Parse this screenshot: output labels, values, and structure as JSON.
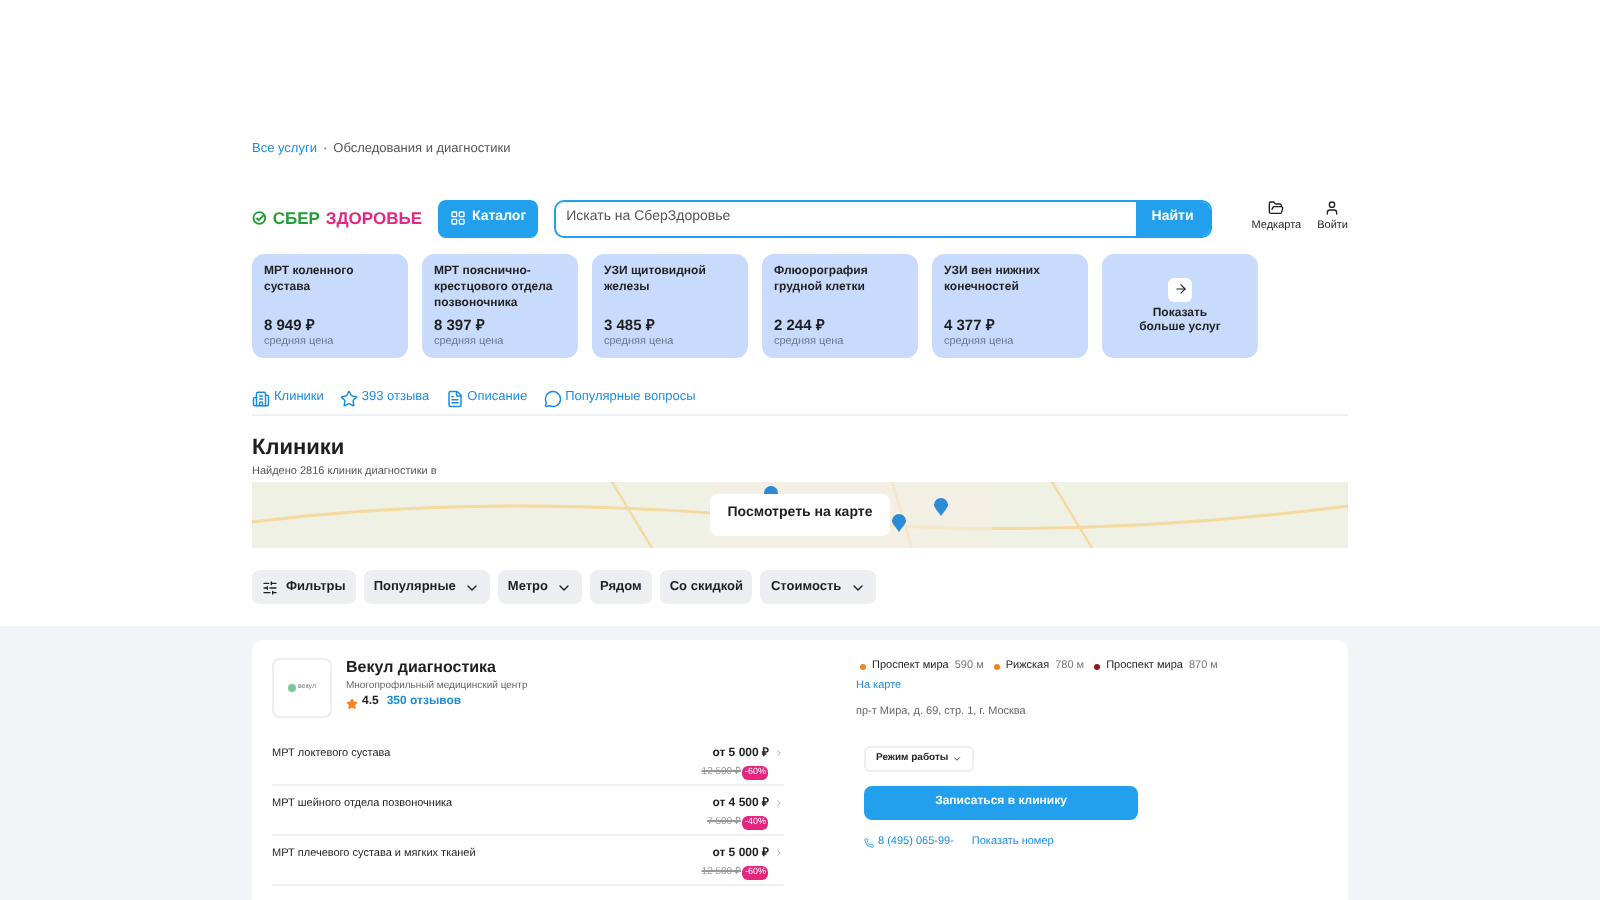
{
  "breadcrumbs": [
    {
      "label": "Все услуги",
      "kind": "link"
    },
    {
      "label": "·",
      "kind": "separator"
    },
    {
      "label": "Обследования и диагностики",
      "kind": "current"
    }
  ],
  "header": {
    "logo_left": "СБЕР",
    "logo_right": "ЗДОРОВЬЕ",
    "catalog_button": "Каталог",
    "search": {
      "placeholder": "Искать на СберЗдоровье"
    },
    "search_button": "Найти",
    "actions": [
      {
        "label": "Медкарта",
        "kind": "medcard"
      },
      {
        "label": "Войти",
        "kind": "user"
      }
    ]
  },
  "services": [
    {
      "title": "МРТ коленного сустава",
      "price": "8 949 ₽",
      "note": "средняя цена"
    },
    {
      "title": "МРТ пояснично-крестцового отдела позвоночника",
      "price": "8 397 ₽",
      "note": "средняя цена"
    },
    {
      "title": "УЗИ щитовидной железы",
      "price": "3 485 ₽",
      "note": "средняя цена"
    },
    {
      "title": "Флюорография грудной клетки",
      "price": "2 244 ₽",
      "note": "средняя цена"
    },
    {
      "title": "УЗИ вен нижних конечностей",
      "price": "4 377 ₽",
      "note": "средняя цена"
    }
  ],
  "more_services": "Показать больше услуг",
  "section_tabs": [
    {
      "label": "Клиники",
      "kind": "clinic"
    },
    {
      "label": "393 отзыва",
      "kind": "star"
    },
    {
      "label": "Описание",
      "kind": "doc"
    },
    {
      "label": "Популярные вопросы",
      "kind": "chat"
    }
  ],
  "clinics": {
    "title": "Клиники",
    "subtitle": "Найдено 2816 клиник диагностики в",
    "map_button": "Посмотреть на карте"
  },
  "filters": [
    {
      "label": "Фильтры",
      "kind": "icon"
    },
    {
      "label": "Популярные",
      "kind": "dropdown"
    },
    {
      "label": "Метро",
      "kind": "dropdown"
    },
    {
      "label": "Рядом",
      "kind": "plain"
    },
    {
      "label": "Со скидкой",
      "kind": "plain"
    },
    {
      "label": "Стоимость",
      "kind": "dropdown"
    }
  ],
  "clinic": {
    "logo": "векул",
    "name": "Векул диагностика",
    "type": "Многопрофильный медицинский центр",
    "rating": "4.5",
    "reviews": "350 отзывов",
    "metro": [
      {
        "name": "Проспект мира",
        "distance": "590 м",
        "color": "#f58220"
      },
      {
        "name": "Рижская",
        "distance": "780 м",
        "color": "#f58220"
      },
      {
        "name": "Проспект мира",
        "distance": "870 м",
        "color": "#8b1a1a"
      }
    ],
    "map_link": "На карте",
    "address": "пр-т Мира, д. 69, стр. 1, г. Москва",
    "services": [
      {
        "name": "МРТ локтевого сустава",
        "price": "от 5 000 ₽",
        "old_price": "12 500 ₽",
        "discount": "-60%"
      },
      {
        "name": "МРТ шейного отдела позвоночника",
        "price": "от 4 500 ₽",
        "old_price": "7 500 ₽",
        "discount": "-40%"
      },
      {
        "name": "МРТ плечевого сустава и мягких тканей",
        "price": "от 5 000 ₽",
        "old_price": "12 500 ₽",
        "discount": "-60%"
      }
    ],
    "hours_button": "Режим работы",
    "book_button": "Записаться в клинику",
    "phone": "8 (495) 065-99-",
    "show_phone": "Показать номер"
  }
}
